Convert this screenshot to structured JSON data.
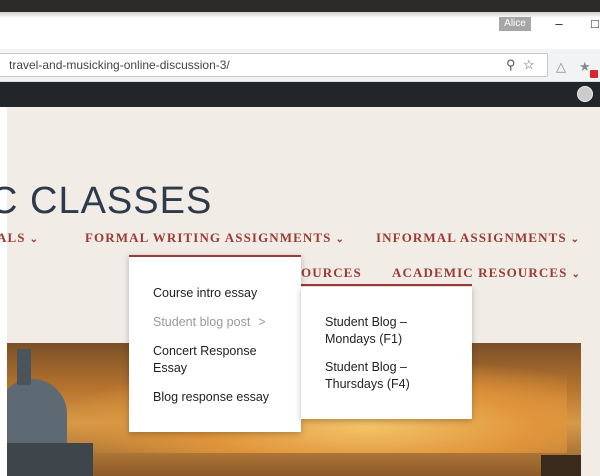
{
  "browser": {
    "user_badge": "Alice",
    "minimize_glyph": "–",
    "maximize_glyph": "□",
    "url": "travel-and-musicking-online-discussion-3/",
    "icons": [
      "key-icon",
      "star-icon",
      "drive-icon",
      "extension-icon"
    ]
  },
  "site": {
    "title": "C CLASSES",
    "nav": {
      "partial_left": "ALS",
      "formal": "FORMAL WRITING ASSIGNMENTS",
      "informal": "INFORMAL ASSIGNMENTS",
      "resources_partial": "OURCES",
      "academic": "ACADEMIC RESOURCES"
    },
    "chevron": "⌄"
  },
  "dropdown_formal": {
    "items": [
      "Course intro essay",
      "Student blog post",
      "Concert Response Essay",
      "Blog response essay"
    ],
    "submenu_arrow": ">"
  },
  "dropdown_blog": {
    "items": [
      "Student Blog – Mondays (F1)",
      "Student Blog – Thursdays (F4)"
    ]
  },
  "colors": {
    "accent": "#9b3b33",
    "title": "#2d3a4c",
    "admin_bar": "#22262b",
    "background": "#f1ece6"
  }
}
